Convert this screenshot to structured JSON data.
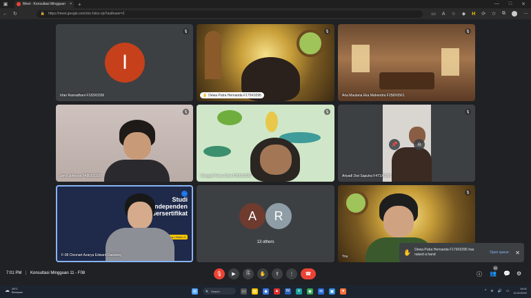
{
  "browser": {
    "tab_title": "Meet - Konsultasi Mingguan",
    "new_tab": "+",
    "url": "https://meet.google.com/ckc-hdcz-zjo?authuser=2"
  },
  "tiles": [
    {
      "name": "Irfan Ramadhani F183X0336",
      "initial": "I"
    },
    {
      "name": "Dewa Putra Hernanda F179X0295"
    },
    {
      "name": "Aria Maulana Eka Mahendra F258X0561"
    },
    {
      "name": "Jerry Johnson F490X1018"
    },
    {
      "name": "Rangga Pranu Setra F266X0598"
    },
    {
      "name": "Ariyadi Dwi Saputra F471X0989"
    },
    {
      "name": "F-08 Cleonart Azarya Edward Datulong"
    },
    {
      "name": "13 others",
      "initial_a": "A",
      "initial_r": "R"
    },
    {
      "name": "You"
    }
  ],
  "slide": {
    "title": "Studi Independen Bersertifikat",
    "sub": "Kampus Merdeka x Batch 3"
  },
  "bottom": {
    "time": "7:01 PM",
    "separator": "|",
    "meeting_name": "Konsultasi Mingguan 11 - F08",
    "participants_count": "21"
  },
  "toast": {
    "message": "Dewa Putra Hernanda F179X0295 has raised a hand",
    "action": "Open queue"
  },
  "taskbar": {
    "temp": "28°C",
    "weather": "Berawan",
    "search": "Search",
    "clock_time": "19:01",
    "clock_date": "11/11/2022"
  },
  "colors": {
    "end_call": "#ea4335",
    "avatar_I": "#c5401b",
    "link": "#8ab4f8"
  }
}
